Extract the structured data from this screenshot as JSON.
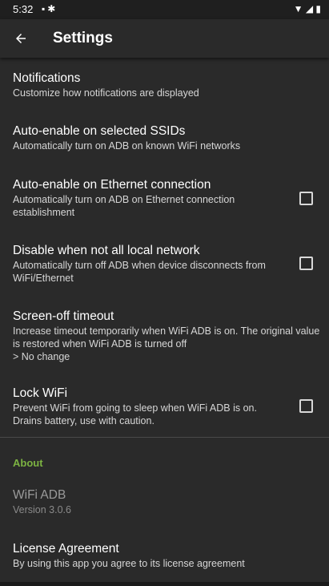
{
  "status_bar": {
    "time": "5:32",
    "notification_icons": [
      "android-notification-icon",
      "bug-notification-icon"
    ],
    "system_icons": [
      "wifi-icon",
      "signal-icon",
      "battery-icon"
    ]
  },
  "app_bar": {
    "title": "Settings",
    "back_icon": "arrow-back-icon"
  },
  "preferences": [
    {
      "title": "Notifications",
      "summary": "Customize how notifications are displayed"
    },
    {
      "title": "Auto-enable on selected SSIDs",
      "summary": "Automatically turn on ADB on known WiFi networks"
    },
    {
      "title": "Auto-enable on Ethernet connection",
      "summary": "Automatically turn on ADB on Ethernet connection establishment",
      "checked": false
    },
    {
      "title": "Disable when not all local network",
      "summary": "Automatically turn off ADB when device disconnects from WiFi/Ethernet",
      "checked": false
    },
    {
      "title": "Screen-off timeout",
      "summary": "Increase timeout temporarily when WiFi ADB is on. The original value is restored when WiFi ADB is turned off",
      "value": "> No change"
    },
    {
      "title": "Lock WiFi",
      "summary": "Prevent WiFi from going to sleep when WiFi ADB is on. Drains battery, use with caution.",
      "checked": false
    }
  ],
  "about": {
    "category_label": "About",
    "app_name": "WiFi ADB",
    "version": "Version 3.0.6",
    "license_title": "License Agreement",
    "license_summary": "By using this app you agree to its license agreement"
  },
  "colors": {
    "background": "#2a2a2a",
    "accent": "#7cb342",
    "text_primary": "#ffffff",
    "text_secondary": "#d6d6d6"
  }
}
